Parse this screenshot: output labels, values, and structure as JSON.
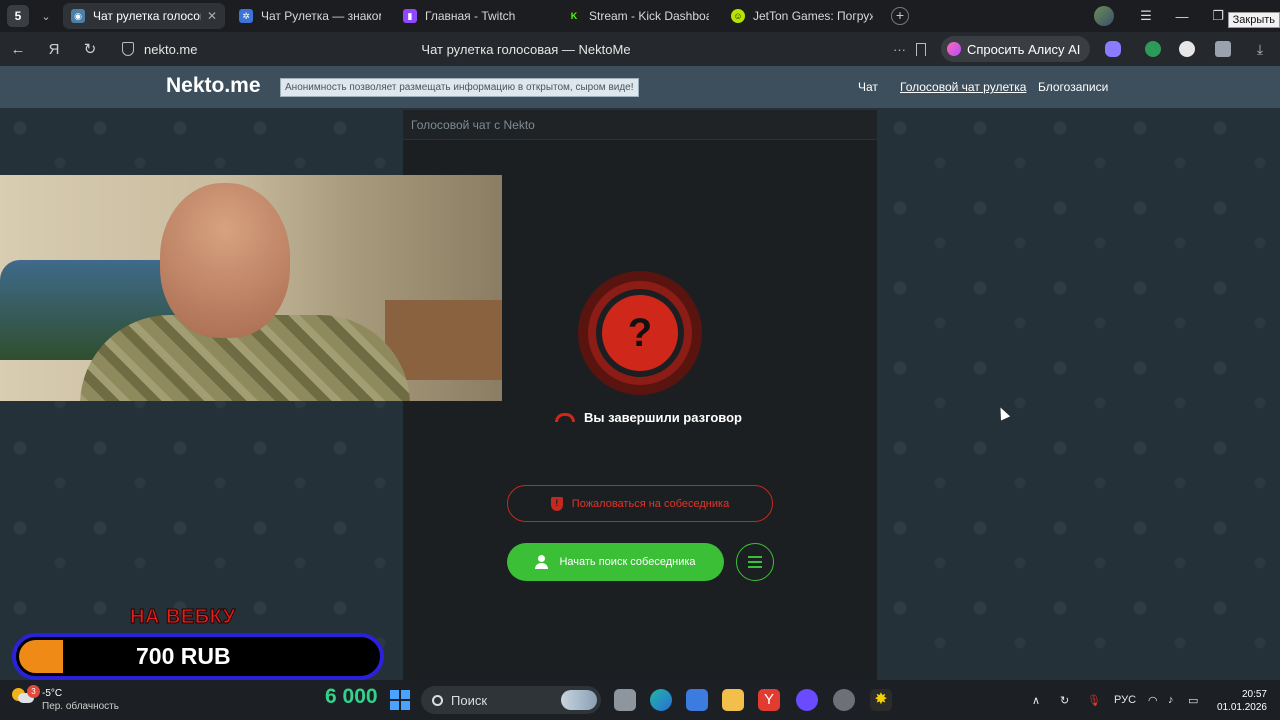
{
  "browser": {
    "tab_counter": "5",
    "tabs": [
      {
        "label": "Чат рулетка голосовая",
        "active": true
      },
      {
        "label": "Чат Рулетка — знакомства",
        "active": false
      },
      {
        "label": "Главная - Twitch",
        "active": false
      },
      {
        "label": "Stream - Kick Dashboard",
        "active": false
      },
      {
        "label": "JetTon Games: Погружение",
        "active": false
      }
    ],
    "close_tooltip": "Закрыть",
    "url": "nekto.me",
    "page_title": "Чат рулетка голосовая — NektoMe",
    "alice_label": "Спросить Алису AI",
    "colors": {
      "tabbar": "#1b1d20",
      "addrbar": "#25282c"
    }
  },
  "site": {
    "logo": "Nekto.me",
    "slogan": "Анонимность позволяет размещать информацию в открытом, сыром виде!",
    "nav": [
      "Чат",
      "Голосовой чат рулетка",
      "Блогозаписи"
    ]
  },
  "chat": {
    "panel_title": "Голосовой чат с Nekto",
    "status_symbol": "?",
    "status_text": "Вы завершили разговор",
    "report_label": "Пожаловаться на собеседника",
    "start_label": "Начать поиск собеседника",
    "colors": {
      "accent_green": "#3bbf37",
      "accent_red": "#d0271b"
    }
  },
  "overlay": {
    "donate_label": "НА ВЕБКУ",
    "donate_amount": "700 RUB",
    "donate_progress": 0.1
  },
  "taskbar": {
    "weather_badge": "3",
    "temperature": "-5°C",
    "weather_desc": "Пер. облачность",
    "counter": "6 000",
    "search_placeholder": "Поиск",
    "language": "РУС",
    "time": "20:57",
    "date": "01.01.2026"
  }
}
